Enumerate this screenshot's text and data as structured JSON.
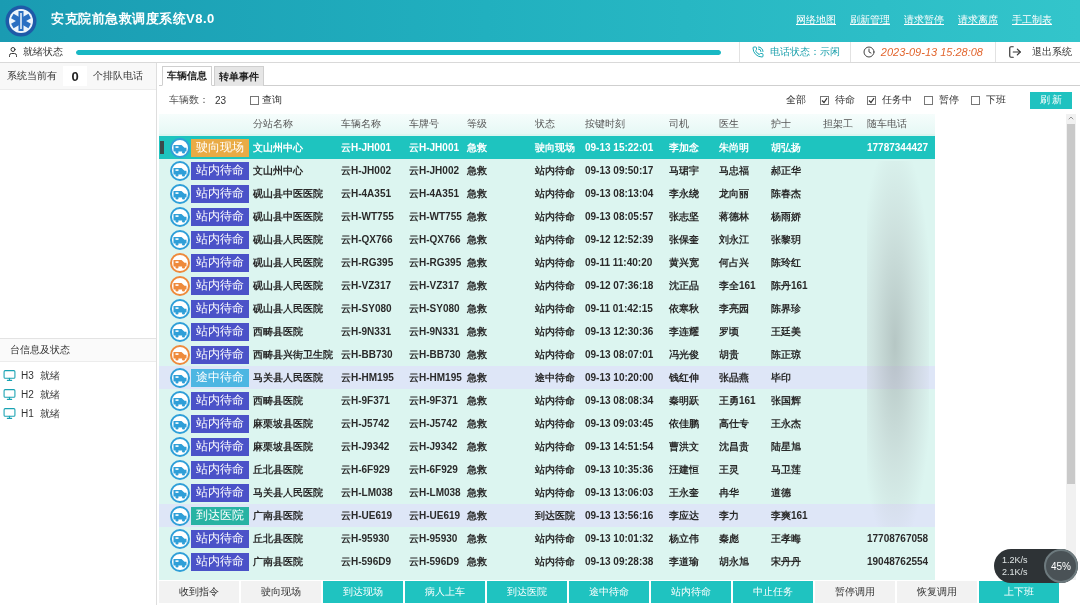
{
  "header": {
    "title": "安克院前急救调度系统V8.0",
    "links": [
      "网络地图",
      "刷新管理",
      "请求暂停",
      "请求离席",
      "手工制表"
    ]
  },
  "status_bar": {
    "state": "就绪状态",
    "progress": {
      "level": 1
    },
    "phone_status": "电话状态：示闲",
    "datetime": "2023-09-13 15:28:08",
    "exit": "退出系统"
  },
  "left_panel": {
    "queue": {
      "prefix": "系统当前有",
      "count": "0",
      "suffix": "个排队电话"
    },
    "stations_title": "台信息及状态",
    "stations": [
      {
        "id": "H3",
        "status": "就绪"
      },
      {
        "id": "H2",
        "status": "就绪"
      },
      {
        "id": "H1",
        "status": "就绪"
      }
    ]
  },
  "tabs": [
    {
      "label": "车辆信息",
      "selected": true
    },
    {
      "label": "转单事件",
      "selected": false
    }
  ],
  "toolbar": {
    "count_label": "车辆数：",
    "count": "23",
    "query": {
      "label": "查询",
      "checked": false
    },
    "all_label": "全部",
    "filters": [
      {
        "label": "待命",
        "checked": true
      },
      {
        "label": "任务中",
        "checked": true
      },
      {
        "label": "暂停",
        "checked": false
      },
      {
        "label": "下班",
        "checked": false
      }
    ],
    "refresh": "刷 新"
  },
  "table": {
    "columns": [
      "分站名称",
      "车辆名称",
      "车牌号",
      "等级",
      "状态",
      "按键时刻",
      "司机",
      "医生",
      "护士",
      "担架工",
      "随车电话"
    ],
    "rows": [
      {
        "selected": true,
        "highlighted": false,
        "color": "#2f9fd8",
        "badge": {
          "text": "驶向现场",
          "color": "#e9ab45"
        },
        "station": "文山州中心",
        "vehicle_name": "云H-JH001",
        "plate": "云H-JH001",
        "grade": "急救",
        "status": "驶向现场",
        "key_time": "09-13 15:22:01",
        "driver": "李加念",
        "doctor": "朱尚明",
        "nurse": "胡弘扬",
        "phone": "17787344427"
      },
      {
        "selected": false,
        "highlighted": false,
        "color": "#2f9fd8",
        "badge": {
          "text": "站内待命",
          "color": "#4b52c8"
        },
        "station": "文山州中心",
        "vehicle_name": "云H-JH002",
        "plate": "云H-JH002",
        "grade": "急救",
        "status": "站内待命",
        "key_time": "09-13 09:50:17",
        "driver": "马珺宇",
        "doctor": "马忠福",
        "nurse": "郝正华"
      },
      {
        "selected": false,
        "highlighted": false,
        "color": "#2f9fd8",
        "badge": {
          "text": "站内待命",
          "color": "#4b52c8"
        },
        "station": "砚山县中医医院",
        "vehicle_name": "云H-4A351",
        "plate": "云H-4A351",
        "grade": "急救",
        "status": "站内待命",
        "key_time": "09-13 08:13:04",
        "driver": "李永绕",
        "doctor": "龙向丽",
        "nurse": "陈春杰"
      },
      {
        "selected": false,
        "highlighted": false,
        "color": "#2f9fd8",
        "badge": {
          "text": "站内待命",
          "color": "#4b52c8"
        },
        "station": "砚山县中医医院",
        "vehicle_name": "云H-WT755",
        "plate": "云H-WT755",
        "grade": "急救",
        "status": "站内待命",
        "key_time": "09-13 08:05:57",
        "driver": "张志坚",
        "doctor": "蒋德林",
        "nurse": "杨雨娇"
      },
      {
        "selected": false,
        "highlighted": false,
        "color": "#2f9fd8",
        "badge": {
          "text": "站内待命",
          "color": "#4b52c8"
        },
        "station": "砚山县人民医院",
        "vehicle_name": "云H-QX766",
        "plate": "云H-QX766",
        "grade": "急救",
        "status": "站内待命",
        "key_time": "09-12 12:52:39",
        "driver": "张保奎",
        "doctor": "刘永江",
        "nurse": "张黎玥"
      },
      {
        "selected": false,
        "highlighted": false,
        "color": "#ee8a3c",
        "badge": {
          "text": "站内待命",
          "color": "#4b52c8"
        },
        "station": "砚山县人民医院",
        "vehicle_name": "云H-RG395",
        "plate": "云H-RG395",
        "grade": "急救",
        "status": "站内待命",
        "key_time": "09-11 11:40:20",
        "driver": "黄兴宽",
        "doctor": "何占兴",
        "nurse": "陈玲红"
      },
      {
        "selected": false,
        "highlighted": false,
        "color": "#ee8a3c",
        "badge": {
          "text": "站内待命",
          "color": "#4b52c8"
        },
        "station": "砚山县人民医院",
        "vehicle_name": "云H-VZ317",
        "plate": "云H-VZ317",
        "grade": "急救",
        "status": "站内待命",
        "key_time": "09-12 07:36:18",
        "driver": "沈正品",
        "doctor": "李全161",
        "nurse": "陈丹161"
      },
      {
        "selected": false,
        "highlighted": false,
        "color": "#2f9fd8",
        "badge": {
          "text": "站内待命",
          "color": "#4b52c8"
        },
        "station": "砚山县人民医院",
        "vehicle_name": "云H-SY080",
        "plate": "云H-SY080",
        "grade": "急救",
        "status": "站内待命",
        "key_time": "09-11 01:42:15",
        "driver": "依寒秋",
        "doctor": "李亮园",
        "nurse": "陈界珍"
      },
      {
        "selected": false,
        "highlighted": false,
        "color": "#2f9fd8",
        "badge": {
          "text": "站内待命",
          "color": "#4b52c8"
        },
        "station": "西畴县医院",
        "vehicle_name": "云H-9N331",
        "plate": "云H-9N331",
        "grade": "急救",
        "status": "站内待命",
        "key_time": "09-13 12:30:36",
        "driver": "李连耀",
        "doctor": "罗顷",
        "nurse": "王廷美"
      },
      {
        "selected": false,
        "highlighted": false,
        "color": "#ee8a3c",
        "badge": {
          "text": "站内待命",
          "color": "#4b52c8"
        },
        "station": "西畴县兴街卫生院",
        "vehicle_name": "云H-BB730",
        "plate": "云H-BB730",
        "grade": "急救",
        "status": "站内待命",
        "key_time": "09-13 08:07:01",
        "driver": "冯光俊",
        "doctor": "胡贵",
        "nurse": "陈正琼"
      },
      {
        "selected": false,
        "highlighted": true,
        "color": "#2f9fd8",
        "badge": {
          "text": "途中待命",
          "color": "#4db6e2"
        },
        "station": "马关县人民医院",
        "vehicle_name": "云H-HM195",
        "plate": "云H-HM195",
        "grade": "急救",
        "status": "途中待命",
        "key_time": "09-13 10:20:00",
        "driver": "钱红伸",
        "doctor": "张品燕",
        "nurse": "毕印"
      },
      {
        "selected": false,
        "highlighted": false,
        "color": "#2f9fd8",
        "badge": {
          "text": "站内待命",
          "color": "#4b52c8"
        },
        "station": "西畴县医院",
        "vehicle_name": "云H-9F371",
        "plate": "云H-9F371",
        "grade": "急救",
        "status": "站内待命",
        "key_time": "09-13 08:08:34",
        "driver": "秦明跃",
        "doctor": "王勇161",
        "nurse": "张国辉"
      },
      {
        "selected": false,
        "highlighted": false,
        "color": "#2f9fd8",
        "badge": {
          "text": "站内待命",
          "color": "#4b52c8"
        },
        "station": "麻栗坡县医院",
        "vehicle_name": "云H-J5742",
        "plate": "云H-J5742",
        "grade": "急救",
        "status": "站内待命",
        "key_time": "09-13 09:03:45",
        "driver": "依佳鹏",
        "doctor": "高仕专",
        "nurse": "王永杰"
      },
      {
        "selected": false,
        "highlighted": false,
        "color": "#2f9fd8",
        "badge": {
          "text": "站内待命",
          "color": "#4b52c8"
        },
        "station": "麻栗坡县医院",
        "vehicle_name": "云H-J9342",
        "plate": "云H-J9342",
        "grade": "急救",
        "status": "站内待命",
        "key_time": "09-13 14:51:54",
        "driver": "曹洪文",
        "doctor": "沈昌贵",
        "nurse": "陆星旭"
      },
      {
        "selected": false,
        "highlighted": false,
        "color": "#2f9fd8",
        "badge": {
          "text": "站内待命",
          "color": "#4b52c8"
        },
        "station": "丘北县医院",
        "vehicle_name": "云H-6F929",
        "plate": "云H-6F929",
        "grade": "急救",
        "status": "站内待命",
        "key_time": "09-13 10:35:36",
        "driver": "汪建恒",
        "doctor": "王灵",
        "nurse": "马卫莲"
      },
      {
        "selected": false,
        "highlighted": false,
        "color": "#2f9fd8",
        "badge": {
          "text": "站内待命",
          "color": "#4b52c8"
        },
        "station": "马关县人民医院",
        "vehicle_name": "云H-LM038",
        "plate": "云H-LM038",
        "grade": "急救",
        "status": "站内待命",
        "key_time": "09-13 13:06:03",
        "driver": "王永奎",
        "doctor": "冉华",
        "nurse": "道德"
      },
      {
        "selected": false,
        "highlighted": true,
        "color": "#2f9fd8",
        "badge": {
          "text": "到达医院",
          "color": "#27b3a3"
        },
        "station": "广南县医院",
        "vehicle_name": "云H-UE619",
        "plate": "云H-UE619",
        "grade": "急救",
        "status": "到达医院",
        "key_time": "09-13 13:56:16",
        "driver": "李应达",
        "doctor": "李力",
        "nurse": "李爽161"
      },
      {
        "selected": false,
        "highlighted": false,
        "color": "#2f9fd8",
        "badge": {
          "text": "站内待命",
          "color": "#4b52c8"
        },
        "station": "丘北县医院",
        "vehicle_name": "云H-95930",
        "plate": "云H-95930",
        "grade": "急救",
        "status": "站内待命",
        "key_time": "09-13 10:01:32",
        "driver": "杨立伟",
        "doctor": "秦彪",
        "nurse": "王孝晦",
        "phone": "17708767058"
      },
      {
        "selected": false,
        "highlighted": false,
        "color": "#2f9fd8",
        "badge": {
          "text": "站内待命",
          "color": "#4b52c8"
        },
        "station": "广南县医院",
        "vehicle_name": "云H-596D9",
        "plate": "云H-596D9",
        "grade": "急救",
        "status": "站内待命",
        "key_time": "09-13 09:28:38",
        "driver": "李道瑜",
        "doctor": "胡永旭",
        "nurse": "宋丹丹",
        "phone": "19048762554"
      }
    ]
  },
  "actions": [
    {
      "label": "收到指令",
      "enabled": false
    },
    {
      "label": "驶向现场",
      "enabled": false
    },
    {
      "label": "到达现场",
      "enabled": true
    },
    {
      "label": "病人上车",
      "enabled": true
    },
    {
      "label": "到达医院",
      "enabled": true
    },
    {
      "label": "途中待命",
      "enabled": true
    },
    {
      "label": "站内待命",
      "enabled": true
    },
    {
      "label": "中止任务",
      "enabled": true
    },
    {
      "label": "暂停调用",
      "enabled": false
    },
    {
      "label": "恢复调用",
      "enabled": false
    },
    {
      "label": "上下班",
      "enabled": true
    }
  ],
  "speed_widget": {
    "upload": "1.2K/s",
    "download": "2.1K/s",
    "percent": "45%"
  }
}
